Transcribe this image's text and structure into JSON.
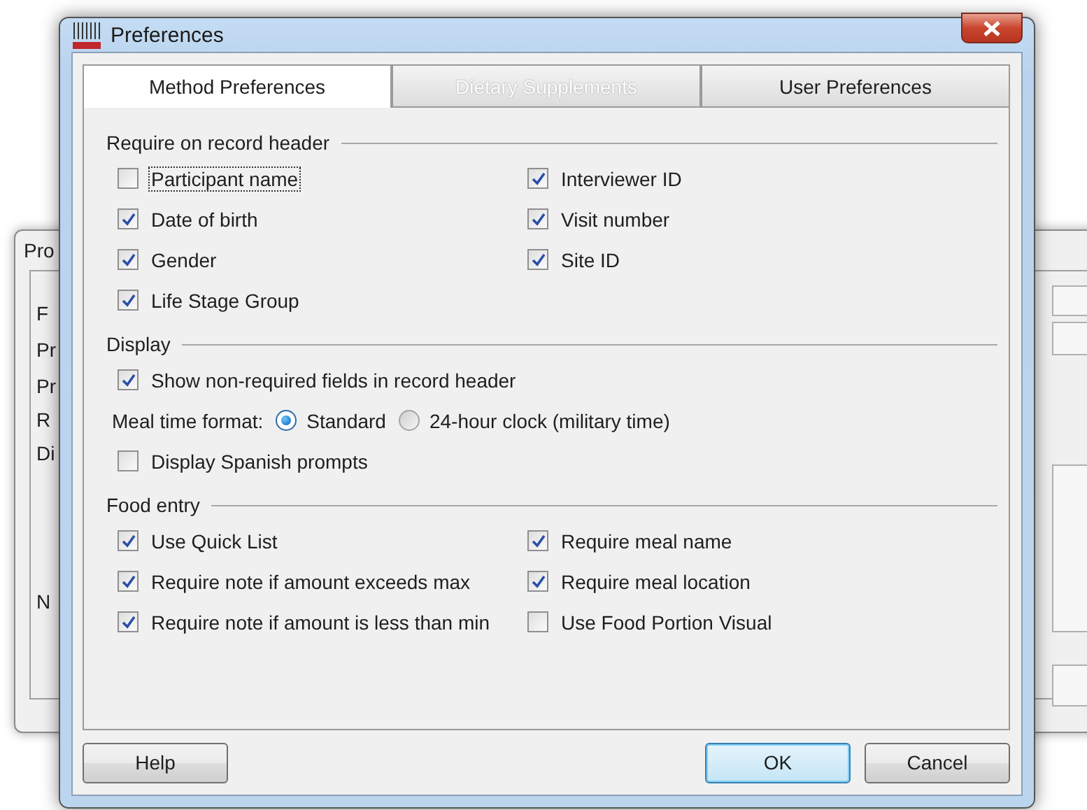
{
  "background_window": {
    "labels": [
      "Pro",
      "F",
      "Pr",
      "Pr",
      "R",
      "Di",
      "N"
    ]
  },
  "window": {
    "title": "Preferences"
  },
  "tabs": [
    {
      "label": "Method Preferences",
      "selected": true,
      "disabled": false
    },
    {
      "label": "Dietary Supplements",
      "selected": false,
      "disabled": true
    },
    {
      "label": "User Preferences",
      "selected": false,
      "disabled": false
    }
  ],
  "sections": [
    {
      "title": "Require on record header",
      "columns": [
        [
          {
            "kind": "checkbox",
            "label": "Participant name",
            "checked": false,
            "focused": true
          },
          {
            "kind": "checkbox",
            "label": "Date of birth",
            "checked": true,
            "focused": false
          },
          {
            "kind": "checkbox",
            "label": "Gender",
            "checked": true,
            "focused": false
          },
          {
            "kind": "checkbox",
            "label": "Life Stage Group",
            "checked": true,
            "focused": false
          }
        ],
        [
          {
            "kind": "checkbox",
            "label": "Interviewer ID",
            "checked": true,
            "focused": false
          },
          {
            "kind": "checkbox",
            "label": "Visit number",
            "checked": true,
            "focused": false
          },
          {
            "kind": "checkbox",
            "label": "Site ID",
            "checked": true,
            "focused": false
          }
        ]
      ]
    },
    {
      "title": "Display",
      "columns": [
        [
          {
            "kind": "checkbox",
            "label": "Show non-required fields in record header",
            "checked": true,
            "focused": false
          },
          {
            "kind": "radio_group",
            "label": "Meal time format:",
            "options": [
              {
                "label": "Standard",
                "selected": true
              },
              {
                "label": "24-hour clock (military time)",
                "selected": false
              }
            ]
          },
          {
            "kind": "checkbox",
            "label": "Display Spanish prompts",
            "checked": false,
            "focused": false
          }
        ]
      ]
    },
    {
      "title": "Food entry",
      "columns": [
        [
          {
            "kind": "checkbox",
            "label": "Use Quick List",
            "checked": true,
            "focused": false
          },
          {
            "kind": "checkbox",
            "label": "Require note if amount exceeds max",
            "checked": true,
            "focused": false
          },
          {
            "kind": "checkbox",
            "label": "Require note if amount is less than min",
            "checked": true,
            "focused": false
          }
        ],
        [
          {
            "kind": "checkbox",
            "label": "Require meal name",
            "checked": true,
            "focused": false
          },
          {
            "kind": "checkbox",
            "label": "Require meal location",
            "checked": true,
            "focused": false
          },
          {
            "kind": "checkbox",
            "label": "Use Food Portion Visual",
            "checked": false,
            "focused": false
          }
        ]
      ]
    }
  ],
  "buttons": [
    {
      "label": "Help",
      "default": false
    },
    {
      "label": "OK",
      "default": true
    },
    {
      "label": "Cancel",
      "default": false
    }
  ]
}
